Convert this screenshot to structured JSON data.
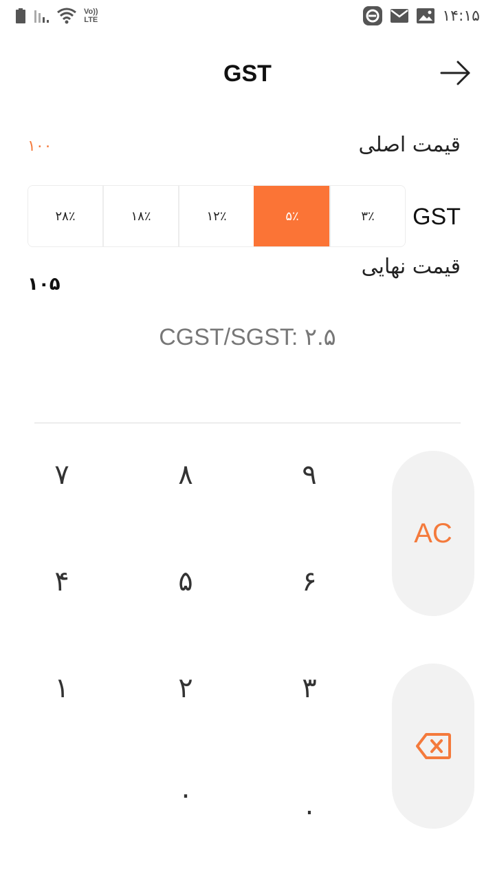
{
  "status_bar": {
    "time": "۱۴:۱۵",
    "volte_top": "Vo))",
    "volte_bottom": "LTE"
  },
  "header": {
    "title": "GST",
    "forward_icon": "arrow-right-icon"
  },
  "original_price": {
    "label": "قیمت اصلی",
    "value": "۱۰۰"
  },
  "gst": {
    "label": "GST",
    "rates": [
      "۳٪",
      "۵٪",
      "۱۲٪",
      "۱۸٪",
      "۲۸٪"
    ],
    "selected_index": 1
  },
  "final_price": {
    "label": "قیمت نهایی",
    "value": "۱۰۵"
  },
  "cgst_sgst": "CGST/SGST: ۲.۵",
  "keypad": {
    "k7": "۷",
    "k8": "۸",
    "k9": "۹",
    "k4": "۴",
    "k5": "۵",
    "k6": "۶",
    "k1": "۱",
    "k2": "۲",
    "k3": "۳",
    "k0": "۰",
    "kdot": ".",
    "clear": "AC",
    "backspace_icon": "backspace-icon"
  },
  "colors": {
    "accent": "#fb7436",
    "side_button_bg": "#f2f2f2"
  }
}
